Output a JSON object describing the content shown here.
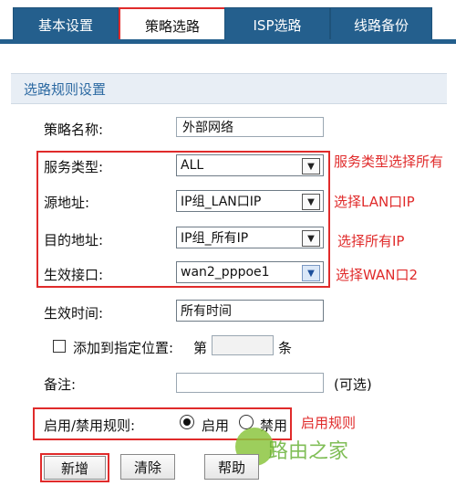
{
  "tabs": [
    {
      "label": "基本设置"
    },
    {
      "label": "策略选路"
    },
    {
      "label": "ISP选路"
    },
    {
      "label": "线路备份"
    }
  ],
  "section_title": "选路规则设置",
  "form": {
    "policy_name": {
      "label": "策略名称:",
      "value": "外部网络"
    },
    "service_type": {
      "label": "服务类型:",
      "value": "ALL"
    },
    "source_address": {
      "label": "源地址:",
      "value": "IP组_LAN口IP"
    },
    "dest_address": {
      "label": "目的地址:",
      "value": "IP组_所有IP"
    },
    "interface": {
      "label": "生效接口:",
      "value": "wan2_pppoe1"
    },
    "effective_time": {
      "label": "生效时间:",
      "value": "所有时间"
    },
    "position": {
      "label": "添加到指定位置:",
      "prefix": "第",
      "suffix": "条",
      "value": ""
    },
    "remark": {
      "label": "备注:",
      "value": "",
      "hint": "(可选)"
    },
    "enable_rule": {
      "label": "启用/禁用规则:",
      "enable": "启用",
      "disable": "禁用"
    }
  },
  "annotations": {
    "service": "服务类型选择所有",
    "source": "选择LAN口IP",
    "dest": "选择所有IP",
    "interface": "选择WAN口2",
    "enable": "启用规则"
  },
  "buttons": {
    "add": "新增",
    "clear": "清除",
    "help": "帮助"
  },
  "watermark": "路由之家",
  "colors": {
    "tab_blue": "#245f8d",
    "highlight_red": "#e02b2b",
    "header_blue": "#2d6aa2"
  }
}
